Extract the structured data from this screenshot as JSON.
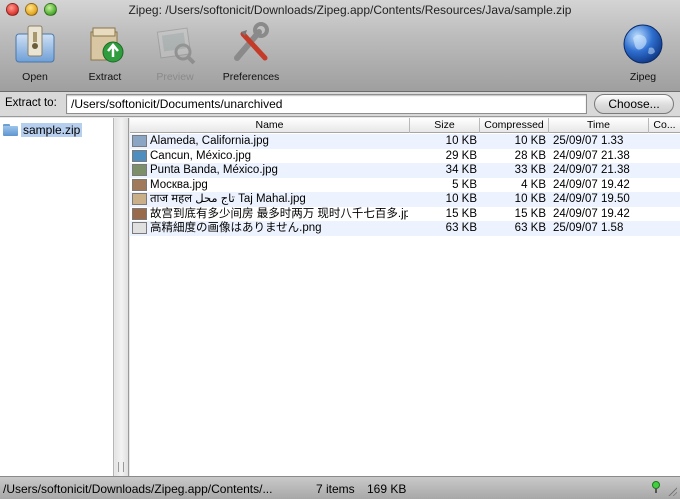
{
  "window": {
    "title": "Zipeg: /Users/softonicit/Downloads/Zipeg.app/Contents/Resources/Java/sample.zip"
  },
  "toolbar": {
    "open_label": "Open",
    "extract_label": "Extract",
    "preview_label": "Preview",
    "preferences_label": "Preferences",
    "zipeg_label": "Zipeg"
  },
  "extract": {
    "label": "Extract to:",
    "path": "/Users/softonicit/Documents/unarchived",
    "choose_label": "Choose..."
  },
  "tree": {
    "items": [
      {
        "label": "sample.zip",
        "icon": "folder-icon"
      }
    ]
  },
  "table": {
    "columns": [
      "Name",
      "Size",
      "Compressed",
      "Time",
      "Co..."
    ],
    "rows": [
      {
        "name": "Alameda, California.jpg",
        "size": "10 KB",
        "compressed": "10 KB",
        "time": "25/09/07 1.33",
        "thumb": "#8ba6c4"
      },
      {
        "name": "Cancun, México.jpg",
        "size": "29 KB",
        "compressed": "28 KB",
        "time": "24/09/07 21.38",
        "thumb": "#4e8fc0"
      },
      {
        "name": "Punta Banda, México.jpg",
        "size": "34 KB",
        "compressed": "33 KB",
        "time": "24/09/07 21.38",
        "thumb": "#7a8f6a"
      },
      {
        "name": "Москва.jpg",
        "size": "5 KB",
        "compressed": "4 KB",
        "time": "24/09/07 19.42",
        "thumb": "#a07a5a"
      },
      {
        "name": "ताज महल تاج محل Taj Mahal.jpg",
        "size": "10 KB",
        "compressed": "10 KB",
        "time": "24/09/07 19.50",
        "thumb": "#c9b089"
      },
      {
        "name": "故宫到底有多少间房 最多时两万 现时八千七百多.jpg",
        "size": "15 KB",
        "compressed": "15 KB",
        "time": "24/09/07 19.42",
        "thumb": "#9a6b4a"
      },
      {
        "name": "高精細度の画像はありません.png",
        "size": "63 KB",
        "compressed": "63 KB",
        "time": "25/09/07 1.58",
        "thumb": "#e0e0e0"
      }
    ]
  },
  "status": {
    "path": "/Users/softonicit/Downloads/Zipeg.app/Contents/...",
    "items": "7 items",
    "size": "169 KB"
  },
  "colors": {
    "selection": "#b7cfee",
    "alternate_row": "#edf3fe"
  }
}
